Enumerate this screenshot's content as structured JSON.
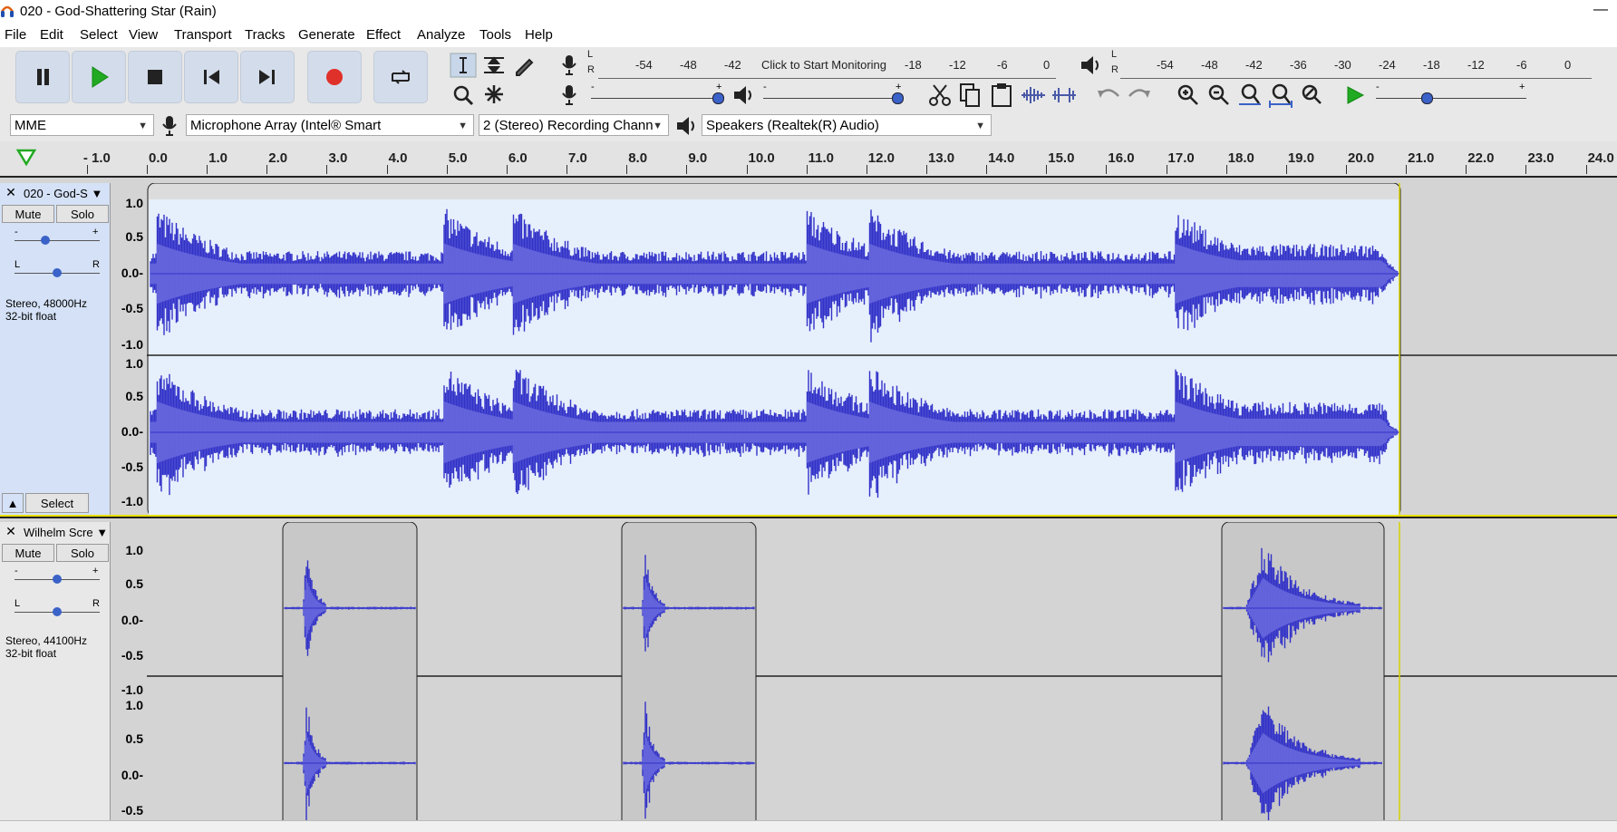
{
  "window": {
    "title": "020 - God-Shattering Star (Rain)",
    "minimize_glyph": "—"
  },
  "menu": [
    "File",
    "Edit",
    "Select",
    "View",
    "Transport",
    "Tracks",
    "Generate",
    "Effect",
    "Analyze",
    "Tools",
    "Help"
  ],
  "meters": {
    "record_ticks": [
      "-54",
      "-48",
      "-42",
      "-18",
      "-12",
      "-6",
      "0"
    ],
    "record_prompt": "Click to Start Monitoring",
    "play_ticks": [
      "-54",
      "-48",
      "-42",
      "-36",
      "-30",
      "-24",
      "-18",
      "-12",
      "-6",
      "0"
    ],
    "lr": [
      "L",
      "R"
    ],
    "slider_minus": "-",
    "slider_plus": "+"
  },
  "devices": {
    "host": "MME",
    "input": "Microphone Array (Intel® Smart",
    "channels": "2 (Stereo) Recording Chann",
    "output": "Speakers (Realtek(R) Audio)"
  },
  "ruler": {
    "labels": [
      "- 1.0",
      "0.0",
      "1.0",
      "2.0",
      "3.0",
      "4.0",
      "5.0",
      "6.0",
      "7.0",
      "8.0",
      "9.0",
      "10.0",
      "11.0",
      "12.0",
      "13.0",
      "14.0",
      "15.0",
      "16.0",
      "17.0",
      "18.0",
      "19.0",
      "20.0",
      "21.0",
      "22.0",
      "23.0",
      "24.0"
    ]
  },
  "tracks": [
    {
      "name": "020 - God-S",
      "close": "✕",
      "mute": "Mute",
      "solo": "Solo",
      "gain_minus": "-",
      "gain_plus": "+",
      "pan_l": "L",
      "pan_r": "R",
      "info_line1": "Stereo, 48000Hz",
      "info_line2": "32-bit float",
      "select_label": "Select",
      "collapse": "▲",
      "scale": [
        "1.0",
        "0.5",
        "0.0-",
        "-0.5",
        "-1.0"
      ],
      "scale2": [
        "1.0",
        "0.5",
        "0.0-",
        "-0.5",
        "-1.0"
      ]
    },
    {
      "name": "Wilhelm Scre",
      "close": "✕",
      "mute": "Mute",
      "solo": "Solo",
      "gain_minus": "-",
      "gain_plus": "+",
      "pan_l": "L",
      "pan_r": "R",
      "info_line1": "Stereo, 44100Hz",
      "info_line2": "32-bit float",
      "scale": [
        "1.0",
        "0.5",
        "0.0-",
        "-0.5",
        "-1.0"
      ],
      "scale2": [
        "1.0",
        "0.5",
        "0.0-",
        "-0.5"
      ]
    }
  ],
  "colors": {
    "waveform": "#3232c8",
    "waveform_rms": "#6464dc",
    "selected_bg": "#e6effc",
    "clip_bg": "#c8c8c8",
    "record_red": "#e0302a",
    "play_green": "#22aa22"
  }
}
